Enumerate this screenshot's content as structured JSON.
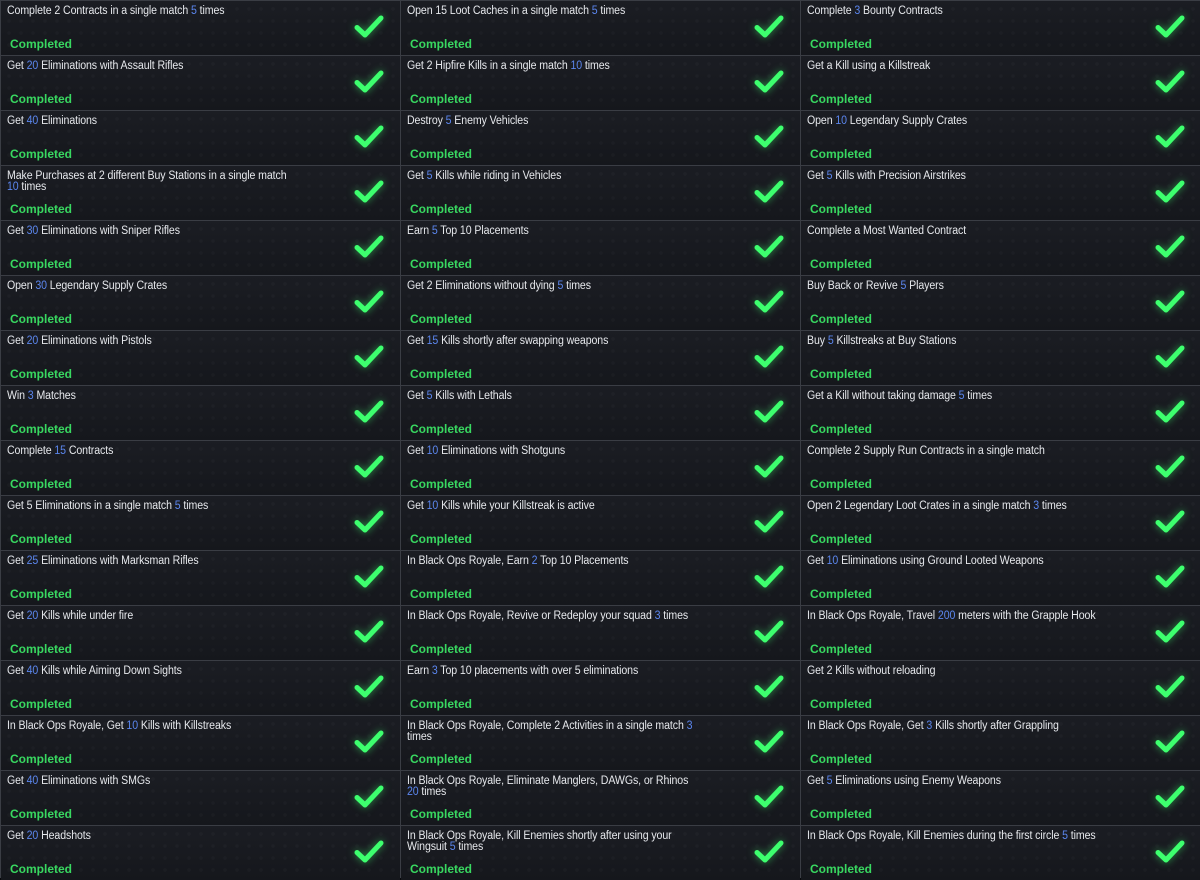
{
  "status_label": "Completed",
  "check_icon": "checkmark-icon",
  "colors": {
    "status": "#38d860",
    "number": "#5b86ee",
    "check": "#3dff6e",
    "text": "#e6e8ec"
  },
  "columns": [
    [
      [
        "Complete 2 Contracts in a single match ",
        {
          "n": "5"
        },
        " times"
      ],
      [
        "Get ",
        {
          "n": "20"
        },
        " Eliminations with Assault Rifles"
      ],
      [
        "Get ",
        {
          "n": "40"
        },
        " Eliminations"
      ],
      [
        "Make Purchases at 2 different Buy Stations in a single match ",
        {
          "n": "10"
        },
        " times"
      ],
      [
        "Get ",
        {
          "n": "30"
        },
        " Eliminations with Sniper Rifles"
      ],
      [
        "Open ",
        {
          "n": "30"
        },
        " Legendary Supply Crates"
      ],
      [
        "Get ",
        {
          "n": "20"
        },
        " Eliminations with Pistols"
      ],
      [
        "Win ",
        {
          "n": "3"
        },
        " Matches"
      ],
      [
        "Complete ",
        {
          "n": "15"
        },
        " Contracts"
      ],
      [
        "Get 5 Eliminations in a single match ",
        {
          "n": "5"
        },
        " times"
      ],
      [
        "Get ",
        {
          "n": "25"
        },
        " Eliminations with Marksman Rifles"
      ],
      [
        "Get ",
        {
          "n": "20"
        },
        " Kills while under fire"
      ],
      [
        "Get ",
        {
          "n": "40"
        },
        " Kills while Aiming Down Sights"
      ],
      [
        "In Black Ops Royale, Get ",
        {
          "n": "10"
        },
        " Kills with Killstreaks"
      ],
      [
        "Get ",
        {
          "n": "40"
        },
        " Eliminations with SMGs"
      ],
      [
        "Get ",
        {
          "n": "20"
        },
        " Headshots"
      ]
    ],
    [
      [
        "Open 15 Loot Caches in a single match ",
        {
          "n": "5"
        },
        " times"
      ],
      [
        "Get 2 Hipfire Kills in a single match ",
        {
          "n": "10"
        },
        " times"
      ],
      [
        "Destroy ",
        {
          "n": "5"
        },
        " Enemy Vehicles"
      ],
      [
        "Get ",
        {
          "n": "5"
        },
        " Kills while riding in Vehicles"
      ],
      [
        "Earn ",
        {
          "n": "5"
        },
        " Top 10 Placements"
      ],
      [
        "Get 2 Eliminations without dying ",
        {
          "n": "5"
        },
        " times"
      ],
      [
        "Get ",
        {
          "n": "15"
        },
        " Kills shortly after swapping weapons"
      ],
      [
        "Get ",
        {
          "n": "5"
        },
        " Kills with Lethals"
      ],
      [
        "Get ",
        {
          "n": "10"
        },
        " Eliminations with Shotguns"
      ],
      [
        "Get ",
        {
          "n": "10"
        },
        " Kills while your Killstreak is active"
      ],
      [
        "In Black Ops Royale, Earn ",
        {
          "n": "2"
        },
        " Top 10 Placements"
      ],
      [
        "In Black Ops Royale, Revive or Redeploy your squad ",
        {
          "n": "3"
        },
        " times"
      ],
      [
        "Earn ",
        {
          "n": "3"
        },
        " Top 10 placements with over 5 eliminations"
      ],
      [
        "In Black Ops Royale, Complete 2 Activities in a single match ",
        {
          "n": "3"
        },
        " times"
      ],
      [
        "In Black Ops Royale, Eliminate Manglers, DAWGs, or Rhinos ",
        {
          "n": "20"
        },
        " times"
      ],
      [
        "In Black Ops Royale, Kill Enemies shortly after using your Wingsuit ",
        {
          "n": "5"
        },
        " times"
      ]
    ],
    [
      [
        "Complete ",
        {
          "n": "3"
        },
        " Bounty Contracts"
      ],
      [
        "Get a Kill using a Killstreak"
      ],
      [
        "Open ",
        {
          "n": "10"
        },
        " Legendary Supply Crates"
      ],
      [
        "Get ",
        {
          "n": "5"
        },
        " Kills with Precision Airstrikes"
      ],
      [
        "Complete a Most Wanted Contract"
      ],
      [
        "Buy Back or Revive ",
        {
          "n": "5"
        },
        " Players"
      ],
      [
        "Buy ",
        {
          "n": "5"
        },
        " Killstreaks at Buy Stations"
      ],
      [
        "Get a Kill without taking damage ",
        {
          "n": "5"
        },
        " times"
      ],
      [
        "Complete 2 Supply Run Contracts in a single match"
      ],
      [
        "Open 2 Legendary Loot Crates in a single match ",
        {
          "n": "3"
        },
        " times"
      ],
      [
        "Get ",
        {
          "n": "10"
        },
        " Eliminations using Ground Looted Weapons"
      ],
      [
        "In Black Ops Royale, Travel ",
        {
          "n": "200"
        },
        " meters with the Grapple Hook"
      ],
      [
        "Get 2 Kills without reloading"
      ],
      [
        "In Black Ops Royale, Get ",
        {
          "n": "3"
        },
        " Kills shortly after Grappling"
      ],
      [
        "Get ",
        {
          "n": "5"
        },
        " Eliminations using Enemy Weapons"
      ],
      [
        "In Black Ops Royale, Kill Enemies during the first circle ",
        {
          "n": "5"
        },
        " times"
      ]
    ]
  ]
}
